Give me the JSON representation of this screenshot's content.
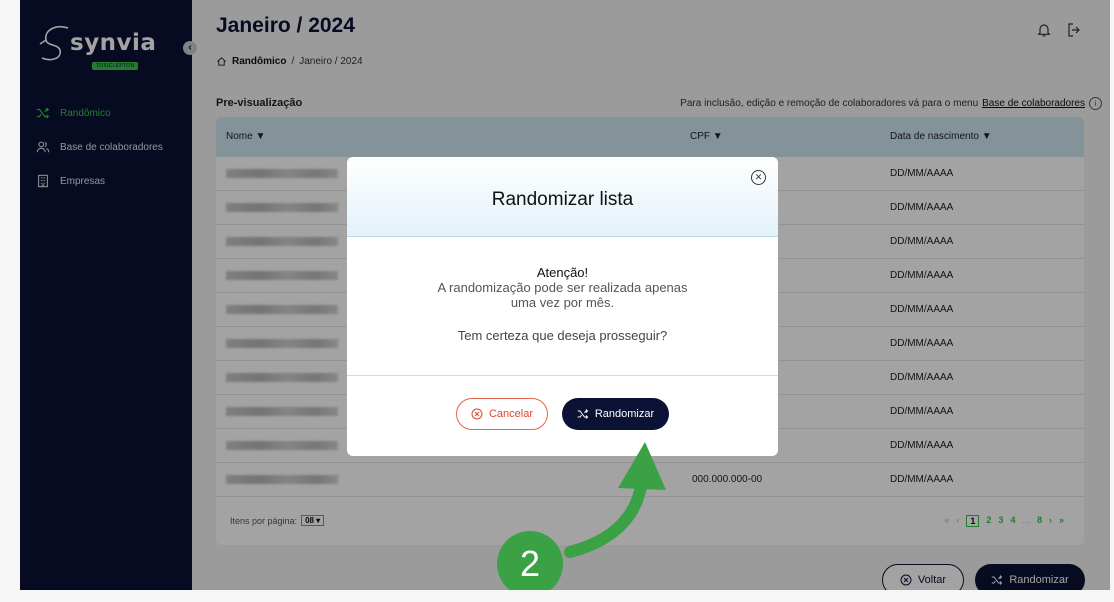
{
  "app": {
    "logo": "synvia",
    "logo_sub": "TOXICLEPTON"
  },
  "sidebar": {
    "items": [
      {
        "label": "Randômico",
        "icon": "shuffle-icon",
        "active": true
      },
      {
        "label": "Base de colaboradores",
        "icon": "users-icon",
        "active": false
      },
      {
        "label": "Empresas",
        "icon": "building-icon",
        "active": false
      }
    ]
  },
  "header": {
    "title": "Janeiro / 2024",
    "breadcrumb": {
      "home": "Randômico",
      "separator": "/",
      "current": "Janeiro / 2024"
    }
  },
  "preview": {
    "label": "Pre-visualização",
    "hint": "Para inclusão, edição e remoção de colaboradores vá para o menu",
    "hint_link": "Base de colaboradores",
    "info": "i"
  },
  "table": {
    "columns": [
      "Nome ▼",
      "CPF ▼",
      "Data de nascimento ▼"
    ],
    "rows": [
      {
        "cpf": "",
        "date": "DD/MM/AAAA"
      },
      {
        "cpf": "",
        "date": "DD/MM/AAAA"
      },
      {
        "cpf": "",
        "date": "DD/MM/AAAA"
      },
      {
        "cpf": "",
        "date": "DD/MM/AAAA"
      },
      {
        "cpf": "",
        "date": "DD/MM/AAAA"
      },
      {
        "cpf": "",
        "date": "DD/MM/AAAA"
      },
      {
        "cpf": "",
        "date": "DD/MM/AAAA"
      },
      {
        "cpf": "",
        "date": "DD/MM/AAAA"
      },
      {
        "cpf": "",
        "date": "DD/MM/AAAA"
      },
      {
        "cpf": "000.000.000-00",
        "date": "DD/MM/AAAA"
      }
    ],
    "per_page_label": "Itens por página:",
    "per_page_value": "08 ▾",
    "pagination": [
      "«",
      "‹",
      "1",
      "2",
      "3",
      "4",
      "...",
      "8",
      "›",
      "»"
    ]
  },
  "actions": {
    "back": "Voltar",
    "randomize": "Randomizar"
  },
  "modal": {
    "title": "Randomizar lista",
    "attention": "Atenção!",
    "message_line1": "A randomização pode ser realizada apenas",
    "message_line2": "uma vez por mês.",
    "question": "Tem certeza que deseja prosseguir?",
    "cancel": "Cancelar",
    "confirm": "Randomizar"
  },
  "annotation": {
    "step": "2",
    "color": "#3aa144"
  },
  "colors": {
    "navy": "#0c1235",
    "green": "#37c24a",
    "header_blue": "#cfe7ef",
    "cancel_red": "#e2664c"
  }
}
